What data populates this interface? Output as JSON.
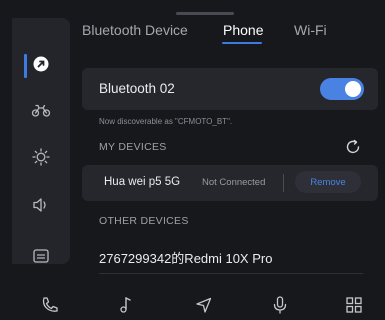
{
  "tabs": [
    {
      "label": "Bluetooth Device",
      "active": false
    },
    {
      "label": "Phone",
      "active": true
    },
    {
      "label": "Wi-Fi",
      "active": false
    }
  ],
  "sidebar": {
    "items": [
      {
        "icon": "bluetooth-settings-icon",
        "active": true
      },
      {
        "icon": "motorcycle-icon",
        "active": false
      },
      {
        "icon": "brightness-icon",
        "active": false
      },
      {
        "icon": "volume-icon",
        "active": false
      },
      {
        "icon": "display-icon",
        "active": false
      }
    ]
  },
  "bluetooth": {
    "name": "Bluetooth 02",
    "enabled": true,
    "discoverable_text": "Now discoverable as \"CFMOTO_BT\"."
  },
  "my_devices": {
    "title": "MY DEVICES",
    "items": [
      {
        "name": "Hua wei p5 5G",
        "status": "Not Connected",
        "action": "Remove"
      }
    ]
  },
  "other_devices": {
    "title": "OTHER DEVICES",
    "items": [
      {
        "name": "2767299342的Redmi 10X Pro"
      }
    ]
  },
  "bottom_nav": [
    {
      "icon": "phone-icon"
    },
    {
      "icon": "music-icon"
    },
    {
      "icon": "navigation-icon"
    },
    {
      "icon": "microphone-icon"
    },
    {
      "icon": "apps-grid-icon"
    }
  ],
  "colors": {
    "accent": "#3d7be0",
    "background": "#17181c",
    "panel": "#26272d"
  }
}
